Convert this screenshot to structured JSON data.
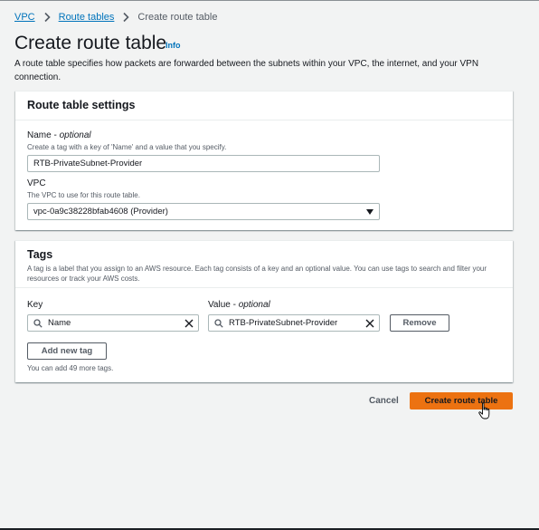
{
  "breadcrumb": {
    "items": [
      "VPC",
      "Route tables"
    ],
    "current": "Create route table"
  },
  "page": {
    "title": "Create route table",
    "info": "Info",
    "description": "A route table specifies how packets are forwarded between the subnets within your VPC, the internet, and your VPN connection."
  },
  "settings": {
    "header": "Route table settings",
    "name_label": "Name",
    "name_optional": "optional",
    "name_desc": "Create a tag with a key of 'Name' and a value that you specify.",
    "name_value": "RTB-PrivateSubnet-Provider",
    "vpc_label": "VPC",
    "vpc_desc": "The VPC to use for this route table.",
    "vpc_value": "vpc-0a9c38228bfab4608 (Provider)"
  },
  "tags": {
    "header": "Tags",
    "description": "A tag is a label that you assign to an AWS resource. Each tag consists of a key and an optional value. You can use tags to search and filter your resources or track your AWS costs.",
    "key_label": "Key",
    "value_label": "Value",
    "value_optional": "optional",
    "key_value": "Name",
    "value_value": "RTB-PrivateSubnet-Provider",
    "remove_label": "Remove",
    "add_label": "Add new tag",
    "limit_note": "You can add 49 more tags."
  },
  "footer": {
    "cancel_label": "Cancel",
    "create_label": "Create route table"
  },
  "colors": {
    "primary": "#ec7211",
    "link": "#0073bb",
    "background": "#f2f3f3"
  }
}
